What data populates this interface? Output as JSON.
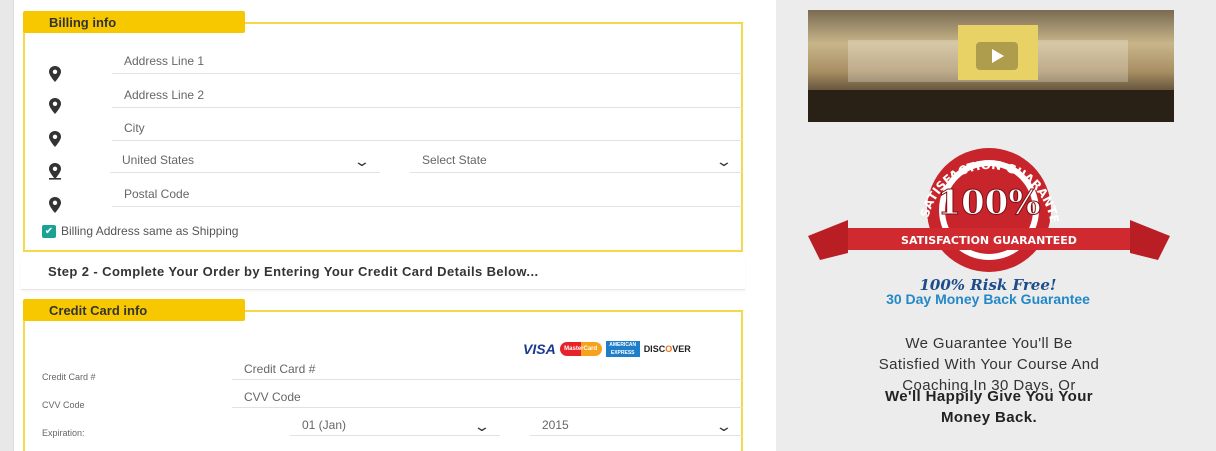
{
  "billing": {
    "tab_label": "Billing info",
    "address1_placeholder": "Address Line 1",
    "address2_placeholder": "Address Line 2",
    "city_placeholder": "City",
    "country_value": "United States",
    "state_value": "Select State",
    "postal_placeholder": "Postal Code",
    "same_as_shipping_label": "Billing Address same as Shipping",
    "same_as_shipping_checked": true
  },
  "step2": {
    "text": "Step 2 - Complete Your Order by Entering Your Credit Card Details Below..."
  },
  "credit_card": {
    "tab_label": "Credit Card info",
    "card_number_label": "Credit Card #",
    "card_number_placeholder": "Credit Card #",
    "cvv_label": "CVV Code",
    "cvv_placeholder": "CVV Code",
    "expiration_label": "Expiration:",
    "exp_month_value": "01 (Jan)",
    "exp_year_value": "2015",
    "card_logos": {
      "visa": "VISA",
      "mastercard": "MasterCard",
      "amex": "AMERICAN EXPRESS",
      "discover_pre": "DISC",
      "discover_o": "O",
      "discover_post": "VER"
    }
  },
  "sidebar": {
    "badge_top_text": "SATISFACTION GUARANTEED",
    "badge_percent": "100%",
    "badge_ribbon_text": "SATISFACTION GUARANTEED",
    "risk_free": "100% Risk Free!",
    "money_back": "30 Day Money Back Guarantee",
    "guarantee_line1": "We Guarantee You'll Be",
    "guarantee_line2": "Satisfied With Your Course And",
    "guarantee_line3": "Coaching In 30 Days, Or",
    "guarantee_bold_line1": "We'll Happily Give You Your",
    "guarantee_bold_line2": "Money Back."
  },
  "colors": {
    "accent_yellow": "#f7c800",
    "box_border": "#f5d94a",
    "checkbox_teal": "#1aa395",
    "badge_red": "#c8242b",
    "link_blue": "#2388c8"
  },
  "icons": {
    "location_pin": "location-pin-icon",
    "chevron": "chevron-down-icon",
    "check": "check-icon",
    "play": "play-icon"
  }
}
